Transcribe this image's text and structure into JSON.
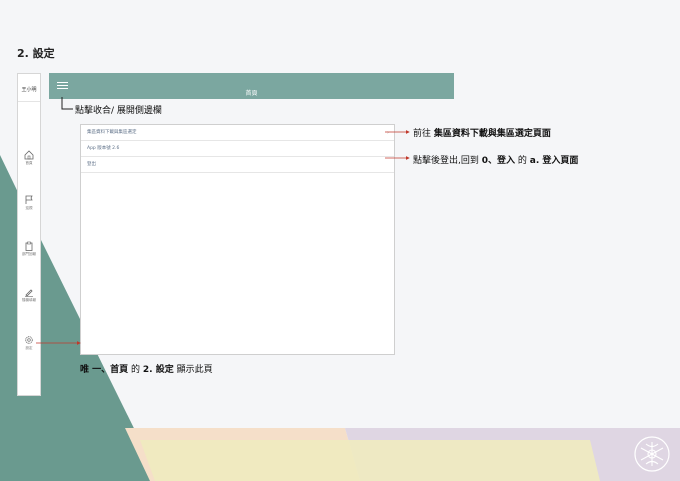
{
  "slide_title": "2. 設定",
  "sidebar": {
    "user_name": "王小明",
    "items": [
      {
        "icon": "home-icon",
        "label": "首頁"
      },
      {
        "icon": "flag-icon",
        "label": "巡視"
      },
      {
        "icon": "clipboard-icon",
        "label": "部門回報"
      },
      {
        "icon": "pencil-icon",
        "label": "隨機填報"
      },
      {
        "icon": "gear-icon",
        "label": "設定"
      }
    ]
  },
  "topbar": {
    "title": "首頁"
  },
  "settings": {
    "rows": [
      {
        "label": "集區資料下載與集區選定",
        "chevron": "›"
      },
      {
        "label": "App 版本號 2.6"
      },
      {
        "label": "登出"
      }
    ]
  },
  "annotations": {
    "menu_note": "點擊收合/ 展開側邊欄",
    "download_note_prefix": "前往",
    "download_note": "集區資料下載與集區選定頁面",
    "logout_note_prefix": "點擊後登出,回到",
    "logout_note_mid": "0、登入",
    "logout_note_of": "的",
    "logout_note_suffix": "a. 登入頁面",
    "only_note_prefix": "唯 一、首頁",
    "only_note_of": "的",
    "only_note_mid": "2. 設定",
    "only_note_suffix": "顯示此頁"
  },
  "colors": {
    "teal": "#7ba7a0",
    "dark_teal": "#6a9a8f",
    "peach": "#f5dfc9",
    "yellow": "#efebbf",
    "lavender": "#dfd6e3",
    "arrow_red": "#c0392b"
  }
}
